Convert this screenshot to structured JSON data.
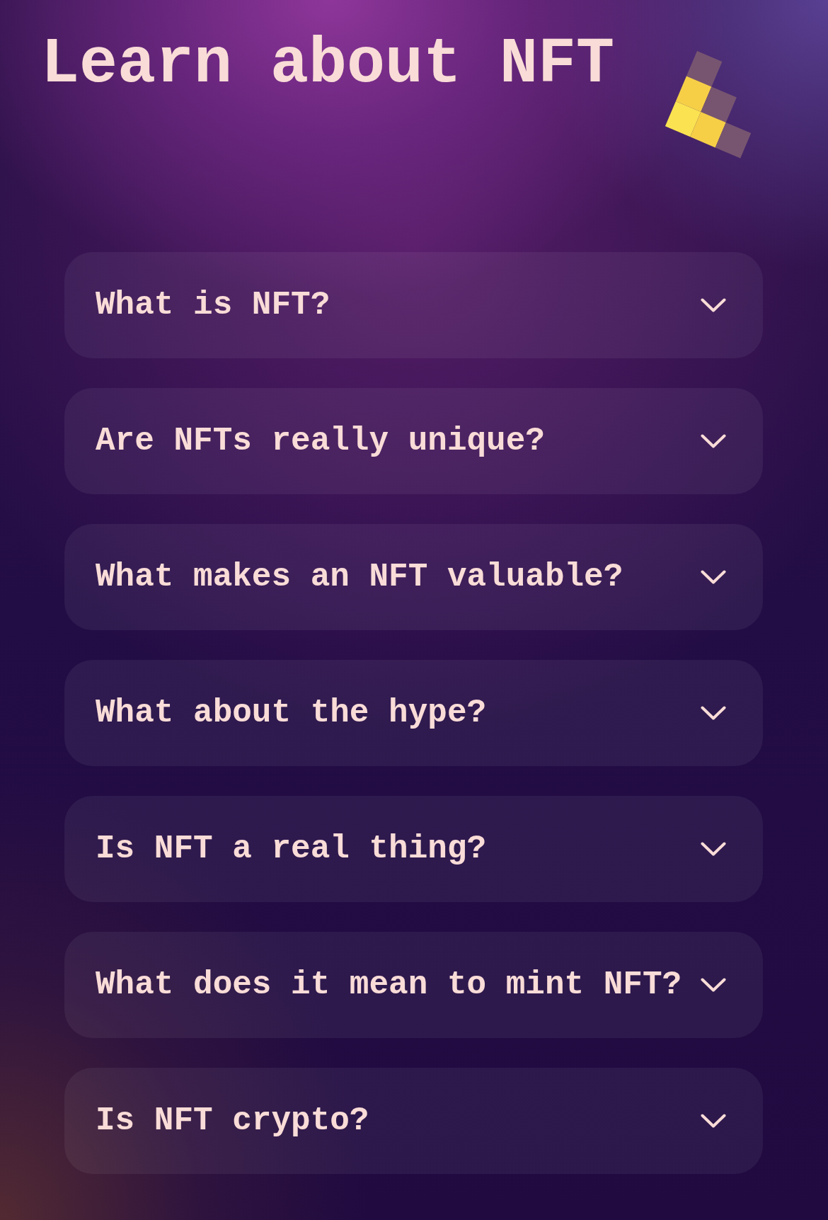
{
  "title": "Learn about NFT",
  "faq": [
    {
      "question": "What is NFT?",
      "expanded": false
    },
    {
      "question": "Are NFTs really unique?",
      "expanded": false
    },
    {
      "question": "What makes an NFT valuable?",
      "expanded": false
    },
    {
      "question": "What about the hype?",
      "expanded": false
    },
    {
      "question": "Is NFT a real thing?",
      "expanded": false
    },
    {
      "question": "What does it mean to mint NFT?",
      "expanded": false
    },
    {
      "question": "Is NFT crypto?",
      "expanded": false
    }
  ]
}
